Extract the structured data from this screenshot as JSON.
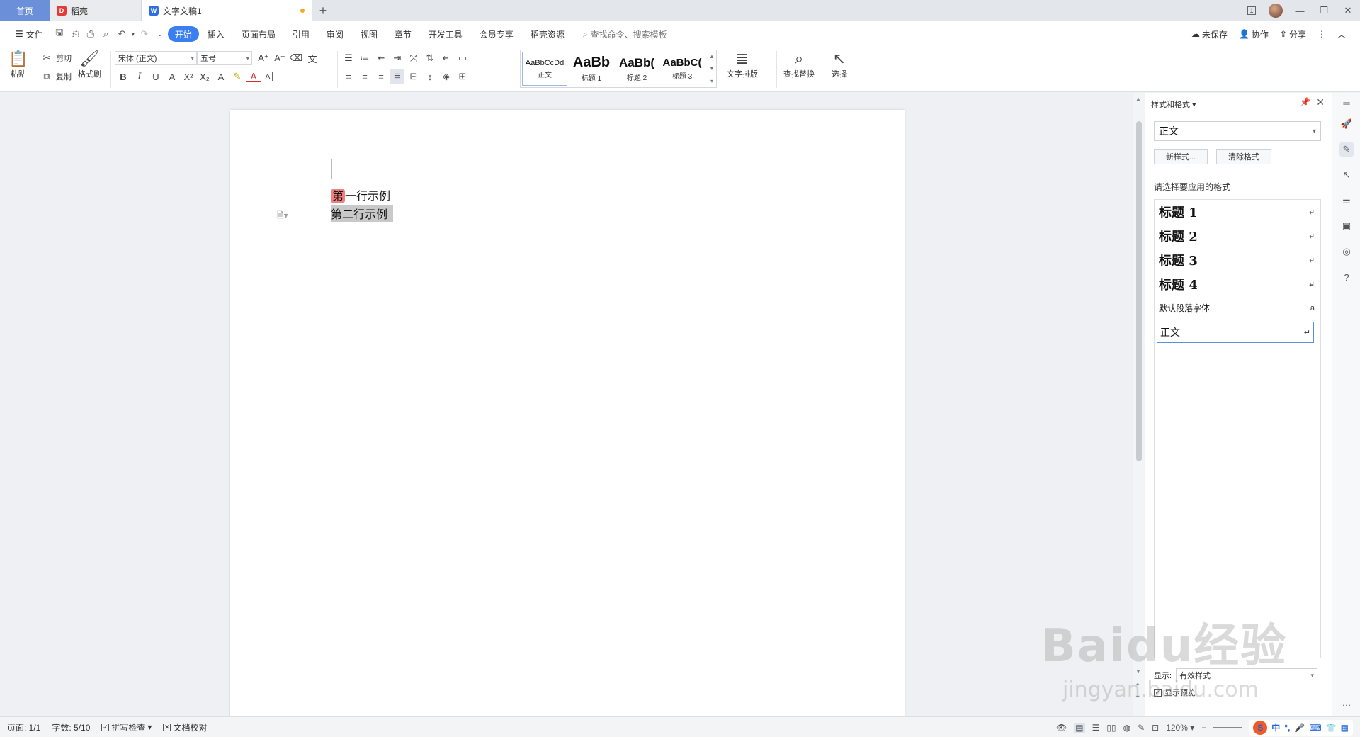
{
  "tabs": [
    {
      "label": "首页"
    },
    {
      "label": "稻壳"
    },
    {
      "label": "文字文稿1"
    }
  ],
  "titlebar": {
    "page_badge": "1"
  },
  "menu": {
    "file": "文件",
    "items": [
      "开始",
      "插入",
      "页面布局",
      "引用",
      "审阅",
      "视图",
      "章节",
      "开发工具",
      "会员专享",
      "稻壳资源"
    ],
    "search_placeholder": "查找命令、搜索模板",
    "unsaved": "未保存",
    "collab": "协作",
    "share": "分享"
  },
  "ribbon": {
    "paste": "粘贴",
    "cut": "剪切",
    "copy": "复制",
    "format_painter": "格式刷",
    "font_name": "宋体 (正文)",
    "font_size": "五号",
    "styles": [
      {
        "sample": "AaBbCcDd",
        "label": "正文"
      },
      {
        "sample": "AaBb",
        "label": "标题 1"
      },
      {
        "sample": "AaBb(",
        "label": "标题 2"
      },
      {
        "sample": "AaBbC(",
        "label": "标题 3"
      }
    ],
    "text_layout": "文字排版",
    "find_replace": "查找替换",
    "select": "选择"
  },
  "document": {
    "line1_first": "第",
    "line1_rest": "一行示例",
    "line2": "第二行示例"
  },
  "side_panel": {
    "title": "样式和格式",
    "current_style": "正文",
    "new_style": "新样式...",
    "clear_format": "清除格式",
    "apply_label": "请选择要应用的格式",
    "entries": [
      {
        "name": "标题  1",
        "mark": "↵"
      },
      {
        "name": "标题  2",
        "mark": "↵"
      },
      {
        "name": "标题  3",
        "mark": "↵"
      },
      {
        "name": "标题  4",
        "mark": "↵"
      },
      {
        "name": "默认段落字体",
        "mark": "a"
      },
      {
        "name": "正文",
        "mark": "↵"
      }
    ],
    "show_label": "显示:",
    "show_value": "有效样式",
    "preview_label": "显示预览"
  },
  "status": {
    "page": "页面: 1/1",
    "words": "字数: 5/10",
    "spell": "拼写检查",
    "proof": "文档校对",
    "zoom": "120%"
  },
  "ime": {
    "zh": "中",
    "punct": "°,"
  },
  "watermark": {
    "brand": "Baidu经验",
    "url": "jingyan.baidu.com"
  },
  "colors": {
    "accent": "#3b7ef0",
    "home_tab": "#6b8fd8",
    "highlight": "#f08080",
    "selection": "#c9c9c9"
  }
}
